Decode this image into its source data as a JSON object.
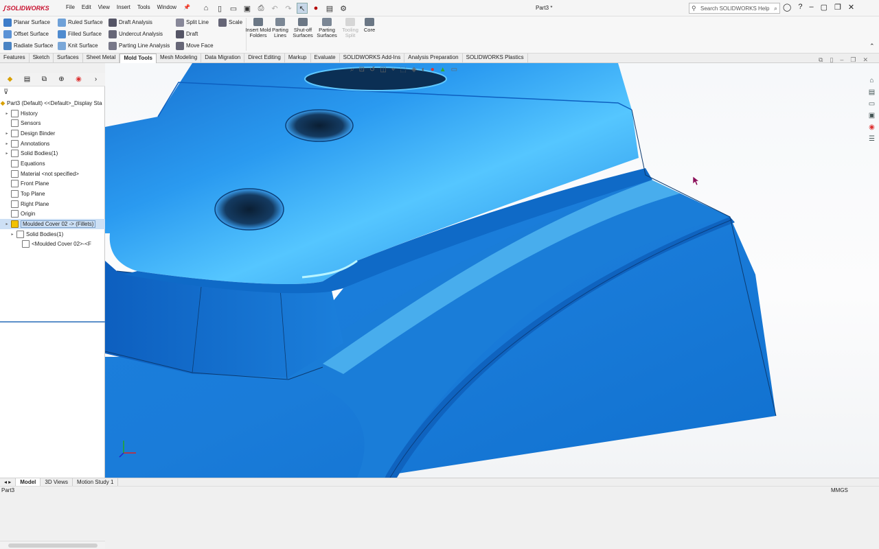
{
  "app": {
    "brand": "SOLIDWORKS",
    "document_title": "Part3 *"
  },
  "menu": [
    "File",
    "Edit",
    "View",
    "Insert",
    "Tools",
    "Window"
  ],
  "search": {
    "placeholder": "Search SOLIDWORKS Help"
  },
  "ribbon": {
    "col1": [
      "Planar Surface",
      "Offset Surface",
      "Radiate Surface"
    ],
    "col2": [
      "Ruled Surface",
      "Filled Surface",
      "Knit Surface"
    ],
    "col3": [
      "Draft Analysis",
      "Undercut Analysis",
      "Parting Line Analysis"
    ],
    "col4": [
      "Split Line",
      "Draft",
      "Move Face"
    ],
    "col5": [
      "Scale"
    ],
    "big": [
      {
        "label": "Insert Mold Folders",
        "enabled": true
      },
      {
        "label": "Parting Lines",
        "enabled": true
      },
      {
        "label": "Shut-off Surfaces",
        "enabled": true
      },
      {
        "label": "Parting Surfaces",
        "enabled": true
      },
      {
        "label": "Tooling Split",
        "enabled": false
      },
      {
        "label": "Core",
        "enabled": true
      }
    ]
  },
  "tabs": {
    "items": [
      "Features",
      "Sketch",
      "Surfaces",
      "Sheet Metal",
      "Mold Tools",
      "Mesh Modeling",
      "Data Migration",
      "Direct Editing",
      "Markup",
      "Evaluate",
      "SOLIDWORKS Add-Ins",
      "Analysis Preparation",
      "SOLIDWORKS Plastics"
    ],
    "active": "Mold Tools"
  },
  "tree": {
    "root": "Part3 (Default) <<Default>_Display Sta",
    "items": [
      {
        "label": "History",
        "indent": 1,
        "arrow": true
      },
      {
        "label": "Sensors",
        "indent": 1,
        "arrow": false
      },
      {
        "label": "Design Binder",
        "indent": 1,
        "arrow": true
      },
      {
        "label": "Annotations",
        "indent": 1,
        "arrow": true
      },
      {
        "label": "Solid Bodies(1)",
        "indent": 1,
        "arrow": true
      },
      {
        "label": "Equations",
        "indent": 1,
        "arrow": false
      },
      {
        "label": "Material <not specified>",
        "indent": 1,
        "arrow": false
      },
      {
        "label": "Front Plane",
        "indent": 1,
        "arrow": false
      },
      {
        "label": "Top Plane",
        "indent": 1,
        "arrow": false
      },
      {
        "label": "Right Plane",
        "indent": 1,
        "arrow": false
      },
      {
        "label": "Origin",
        "indent": 1,
        "arrow": false
      },
      {
        "label": "Moulded Cover 02 -> (Fillets)",
        "indent": 1,
        "arrow": true,
        "selected": true
      },
      {
        "label": "Solid Bodies(1)",
        "indent": 2,
        "arrow": true
      },
      {
        "label": "<Moulded Cover 02>-<F",
        "indent": 3,
        "arrow": false
      }
    ]
  },
  "bottom_tabs": {
    "items": [
      "Model",
      "3D Views",
      "Motion Study 1"
    ],
    "active": "Model"
  },
  "status": {
    "left": "Part3",
    "units": "MMGS"
  },
  "colors": {
    "part_blue": "#1f87e0",
    "highlight": "#5ad0ff",
    "brand_red": "#c8102e"
  }
}
